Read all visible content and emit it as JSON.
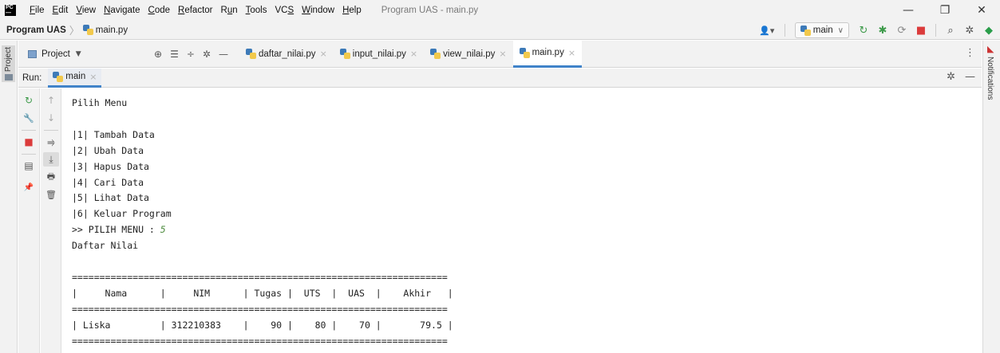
{
  "window": {
    "logo_lines": [
      "PC",
      "—"
    ],
    "menu": [
      {
        "pre": "",
        "u": "F",
        "post": "ile"
      },
      {
        "pre": "",
        "u": "E",
        "post": "dit"
      },
      {
        "pre": "",
        "u": "V",
        "post": "iew"
      },
      {
        "pre": "",
        "u": "N",
        "post": "avigate"
      },
      {
        "pre": "",
        "u": "C",
        "post": "ode"
      },
      {
        "pre": "",
        "u": "R",
        "post": "efactor"
      },
      {
        "pre": "R",
        "u": "u",
        "post": "n"
      },
      {
        "pre": "",
        "u": "T",
        "post": "ools"
      },
      {
        "pre": "VC",
        "u": "S",
        "post": ""
      },
      {
        "pre": "",
        "u": "W",
        "post": "indow"
      },
      {
        "pre": "",
        "u": "H",
        "post": "elp"
      }
    ],
    "title": "Program UAS - main.py",
    "controls": {
      "minimize": "—",
      "restore": "❐",
      "close": "✕"
    }
  },
  "navbar": {
    "project": "Program UAS",
    "separator": "〉",
    "file": "main.py",
    "run_config": "main",
    "run_config_caret": "∨",
    "icons": {
      "account": "👤▾",
      "rerun": "↻",
      "debug": "✱",
      "coverage": "⟳",
      "stop": "■",
      "search": "⌕",
      "settings": "✲",
      "plugin": "◆"
    }
  },
  "project_toolbar": {
    "label": "Project",
    "caret": "▼",
    "tools": [
      "⊕",
      "☰",
      "÷",
      "✲",
      "—"
    ],
    "kebab": "⋮"
  },
  "tabs": [
    {
      "label": "daftar_nilai.py",
      "close": "×",
      "active": false
    },
    {
      "label": "input_nilai.py",
      "close": "×",
      "active": false
    },
    {
      "label": "view_nilai.py",
      "close": "×",
      "active": false
    },
    {
      "label": "main.py",
      "close": "×",
      "active": true
    }
  ],
  "left_stripe": {
    "project_label": "Project"
  },
  "right_stripe": {
    "notifications_label": "Notifications",
    "icon": "◣"
  },
  "run_window": {
    "label": "Run:",
    "tab": "main",
    "tab_close": "×",
    "header_icons": {
      "settings": "✲",
      "hide": "—"
    },
    "tools_col1": {
      "rerun": "↻",
      "wrench": "🔧",
      "stop": "■",
      "layout": "▤",
      "pin": "📌"
    },
    "tools_col2": {
      "up": "↑",
      "down": "↓",
      "soft_wrap": "⥤",
      "scroll_end": "⤓",
      "print": "🖶",
      "trash": "🗑"
    }
  },
  "console": {
    "lines_before_input": [
      "Pilih Menu",
      "",
      "|1| Tambah Data",
      "|2| Ubah Data",
      "|3| Hapus Data",
      "|4| Cari Data",
      "|5| Lihat Data",
      "|6| Keluar Program"
    ],
    "prompt": ">> PILIH MENU : ",
    "input_value": "5",
    "lines_after_input": [
      "Daftar Nilai",
      "",
      "====================================================================",
      "|     Nama      |     NIM      | Tugas |  UTS  |  UAS  |    Akhir   |",
      "====================================================================",
      "| Liska         | 312210383    |    90 |    80 |    70 |       79.5 |",
      "===================================================================="
    ]
  },
  "colors": {
    "accent_blue": "#4083c9",
    "input_green": "#4b8a3c",
    "stop_red": "#db3b3b",
    "run_green": "#3d9a4a"
  }
}
